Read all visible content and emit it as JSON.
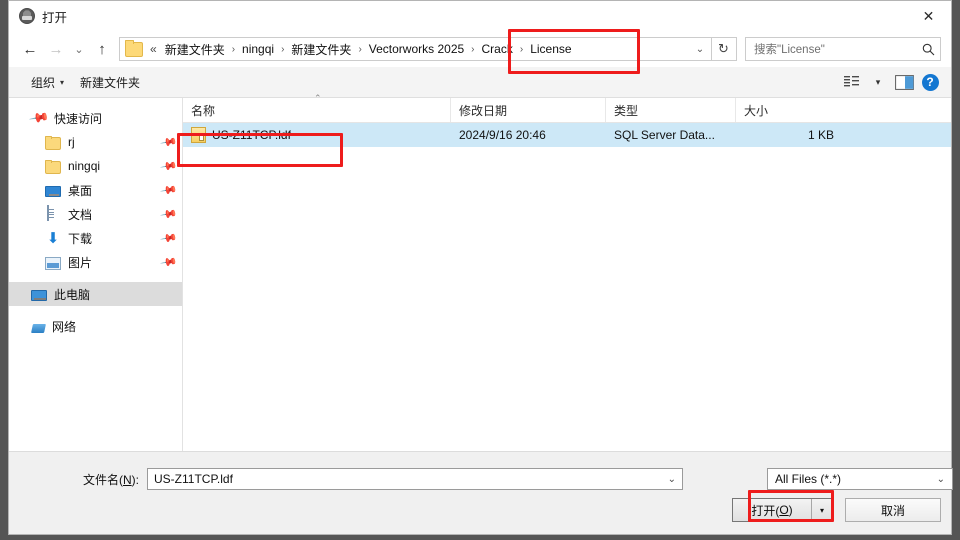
{
  "window": {
    "title": "打开",
    "app_icon": "app-circle-icon",
    "close_label": "✕"
  },
  "navigation": {
    "back_icon": "←",
    "forward_icon": "→",
    "recent_icon": "⌄",
    "up_icon": "↑",
    "refresh_icon": "↻",
    "address_dropdown_icon": "⌄",
    "breadcrumb_prefix": "«",
    "separator": "›",
    "breadcrumbs": [
      "新建文件夹",
      "ningqi",
      "新建文件夹",
      "Vectorworks 2025",
      "Crack",
      "License"
    ]
  },
  "search": {
    "placeholder": "搜索\"License\"",
    "icon": "search-icon"
  },
  "toolbar": {
    "organize_label": "组织",
    "organize_caret": "▾",
    "new_folder_label": "新建文件夹",
    "view_icon": "view-list-icon",
    "view_caret": "▾",
    "preview_pane_icon": "preview-pane-icon",
    "help_label": "?"
  },
  "sidebar": {
    "items": [
      {
        "label": "快速访问",
        "icon": "pin-icon",
        "sub": false,
        "pinned": false,
        "selected": false
      },
      {
        "label": "rj",
        "icon": "folder-icon",
        "sub": true,
        "pinned": true,
        "selected": false
      },
      {
        "label": "ningqi",
        "icon": "folder-icon",
        "sub": true,
        "pinned": true,
        "selected": false
      },
      {
        "label": "桌面",
        "icon": "desktop-icon",
        "sub": true,
        "pinned": true,
        "selected": false
      },
      {
        "label": "文档",
        "icon": "documents-icon",
        "sub": true,
        "pinned": true,
        "selected": false
      },
      {
        "label": "下载",
        "icon": "downloads-icon",
        "sub": true,
        "pinned": true,
        "selected": false
      },
      {
        "label": "图片",
        "icon": "pictures-icon",
        "sub": true,
        "pinned": true,
        "selected": false
      },
      {
        "label": "此电脑",
        "icon": "this-pc-icon",
        "sub": false,
        "pinned": false,
        "selected": true
      },
      {
        "label": "网络",
        "icon": "network-icon",
        "sub": false,
        "pinned": false,
        "selected": false
      }
    ],
    "pin_glyph": "📌"
  },
  "filelist": {
    "columns": {
      "name": "名称",
      "date": "修改日期",
      "type": "类型",
      "size": "大小"
    },
    "sort_caret": "⌃",
    "rows": [
      {
        "name": "US-Z11TCP.ldf",
        "date": "2024/9/16 20:46",
        "type": "SQL Server Data...",
        "size": "1 KB",
        "icon": "ldf-file-icon",
        "selected": true
      }
    ]
  },
  "footer": {
    "filename_label_prefix": "文件名(",
    "filename_label_key": "N",
    "filename_label_suffix": "):",
    "filename_value": "US-Z11TCP.ldf",
    "filename_dropdown_icon": "⌄",
    "filetype_value": "All Files (*.*)",
    "filetype_dropdown_icon": "⌄",
    "open_label_prefix": "打开(",
    "open_label_key": "O",
    "open_label_suffix": ")",
    "open_split_icon": "▾",
    "cancel_label": "取消"
  },
  "annotations": {
    "accent_color": "#ee1c1c",
    "boxes": [
      "breadcrumb-crack-license",
      "selected-file-row",
      "open-button"
    ]
  }
}
